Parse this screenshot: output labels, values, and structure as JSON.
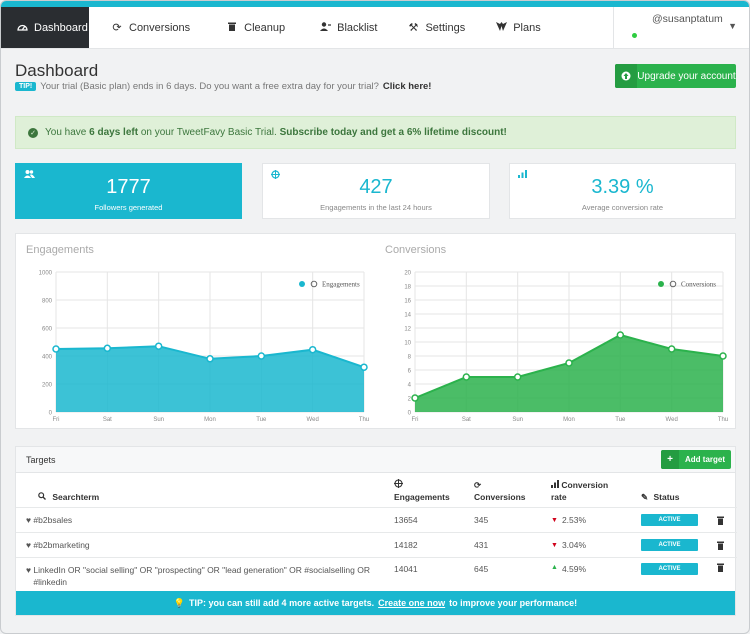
{
  "nav": {
    "items": [
      {
        "label": "Dashboard",
        "icon": "speedometer-icon"
      },
      {
        "label": "Conversions",
        "icon": "refresh-icon"
      },
      {
        "label": "Cleanup",
        "icon": "trash-icon"
      },
      {
        "label": "Blacklist",
        "icon": "user-block-icon"
      },
      {
        "label": "Settings",
        "icon": "tools-icon"
      },
      {
        "label": "Plans",
        "icon": "plans-icon"
      }
    ],
    "user": "@susanptatum"
  },
  "header": {
    "title": "Dashboard",
    "tip_badge": "TIP!",
    "tip_text": "Your trial (Basic plan) ends in 6 days. Do you want a free extra day for your trial?",
    "tip_link": "Click here!",
    "upgrade_label": "Upgrade your account"
  },
  "alert": {
    "pre": "You have",
    "days": "6 days left",
    "mid": "on your TweetFavy Basic Trial.",
    "cta": "Subscribe today and get a 6% lifetime discount!"
  },
  "stats": [
    {
      "value": "1777",
      "label": "Followers generated"
    },
    {
      "value": "427",
      "label": "Engagements in the last 24 hours"
    },
    {
      "value": "3.39 %",
      "label": "Average conversion rate"
    }
  ],
  "chart_data": [
    {
      "type": "area",
      "title": "Engagements",
      "categories": [
        "Fri",
        "Sat",
        "Sun",
        "Mon",
        "Tue",
        "Wed",
        "Thu"
      ],
      "series": [
        {
          "name": "Engagements",
          "values": [
            450,
            455,
            470,
            380,
            400,
            445,
            320
          ]
        }
      ],
      "ylim": [
        0,
        1000
      ],
      "yticks": [
        0,
        200,
        400,
        600,
        800,
        1000
      ],
      "grid": true,
      "legend": "top-right",
      "color": "#1ab7cf"
    },
    {
      "type": "area",
      "title": "Conversions",
      "categories": [
        "Fri",
        "Sat",
        "Sun",
        "Mon",
        "Tue",
        "Wed",
        "Thu"
      ],
      "series": [
        {
          "name": "Conversions",
          "values": [
            2,
            5,
            5,
            7,
            11,
            9,
            8
          ]
        }
      ],
      "ylim": [
        0,
        20
      ],
      "yticks": [
        0,
        2,
        4,
        6,
        8,
        10,
        12,
        14,
        16,
        18,
        20
      ],
      "grid": true,
      "legend": "top-right",
      "color": "#2bb24c"
    }
  ],
  "targets": {
    "title": "Targets",
    "add_label": "Add target",
    "columns": {
      "searchterm": "Searchterm",
      "engagements": "Engagements",
      "conversions": "Conversions",
      "rate_l1": "Conversion",
      "rate_l2": "rate",
      "status": "Status"
    },
    "rows": [
      {
        "term": "#b2bsales",
        "engagements": "13654",
        "conversions": "345",
        "rate": "2.53%",
        "trend": "down",
        "status": "ACTIVE"
      },
      {
        "term": "#b2bmarketing",
        "engagements": "14182",
        "conversions": "431",
        "rate": "3.04%",
        "trend": "down",
        "status": "ACTIVE"
      },
      {
        "term": "LinkedIn OR \"social selling\" OR \"prospecting\" OR \"lead generation\" OR #socialselling OR #linkedin",
        "engagements": "14041",
        "conversions": "645",
        "rate": "4.59%",
        "trend": "up",
        "status": "ACTIVE"
      }
    ],
    "footer_pre": "TIP: you can still add 4 more active targets.",
    "footer_link": "Create one now",
    "footer_post": "to improve your performance!"
  }
}
